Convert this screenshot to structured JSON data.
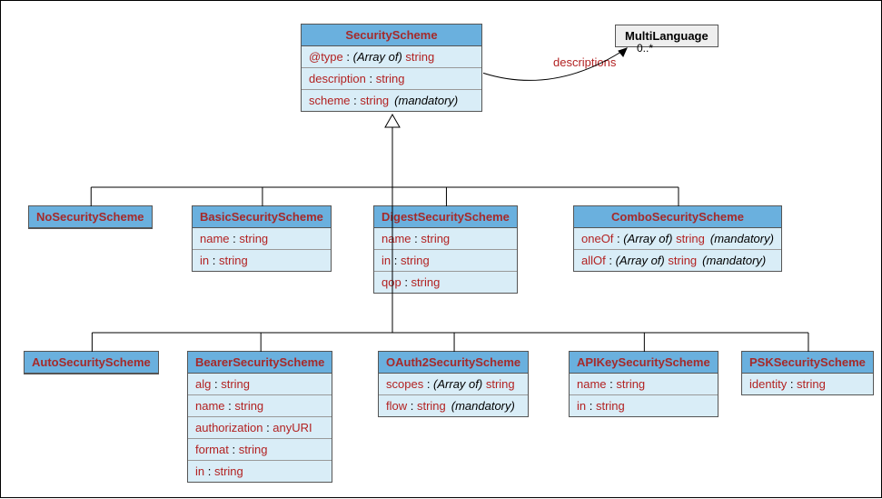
{
  "root": {
    "name": "SecurityScheme",
    "attrs": [
      {
        "name": "@type",
        "array": true,
        "type": "string",
        "mandatory": false
      },
      {
        "name": "description",
        "array": false,
        "type": "string",
        "mandatory": false
      },
      {
        "name": "scheme",
        "array": false,
        "type": "string",
        "mandatory": true
      }
    ]
  },
  "external": {
    "name": "MultiLanguage"
  },
  "assoc": {
    "label": "descriptions",
    "mult": "0..*"
  },
  "subs1": [
    {
      "name": "NoSecurityScheme",
      "attrs": []
    },
    {
      "name": "BasicSecurityScheme",
      "attrs": [
        {
          "name": "name",
          "type": "string"
        },
        {
          "name": "in",
          "type": "string"
        }
      ]
    },
    {
      "name": "DigestSecurityScheme",
      "attrs": [
        {
          "name": "name",
          "type": "string"
        },
        {
          "name": "in",
          "type": "string"
        },
        {
          "name": "qop",
          "type": "string"
        }
      ]
    },
    {
      "name": "ComboSecurityScheme",
      "attrs": [
        {
          "name": "oneOf",
          "array": true,
          "type": "string",
          "mandatory": true
        },
        {
          "name": "allOf",
          "array": true,
          "type": "string",
          "mandatory": true
        }
      ]
    }
  ],
  "subs2": [
    {
      "name": "AutoSecurityScheme",
      "attrs": []
    },
    {
      "name": "BearerSecurityScheme",
      "attrs": [
        {
          "name": "alg",
          "type": "string"
        },
        {
          "name": "name",
          "type": "string"
        },
        {
          "name": "authorization",
          "type": "anyURI"
        },
        {
          "name": "format",
          "type": "string"
        },
        {
          "name": "in",
          "type": "string"
        }
      ]
    },
    {
      "name": "OAuth2SecurityScheme",
      "attrs": [
        {
          "name": "scopes",
          "array": true,
          "type": "string"
        },
        {
          "name": "flow",
          "type": "string",
          "mandatory": true
        }
      ]
    },
    {
      "name": "APIKeySecurityScheme",
      "attrs": [
        {
          "name": "name",
          "type": "string"
        },
        {
          "name": "in",
          "type": "string"
        }
      ]
    },
    {
      "name": "PSKSecurityScheme",
      "attrs": [
        {
          "name": "identity",
          "type": "string"
        }
      ]
    }
  ]
}
